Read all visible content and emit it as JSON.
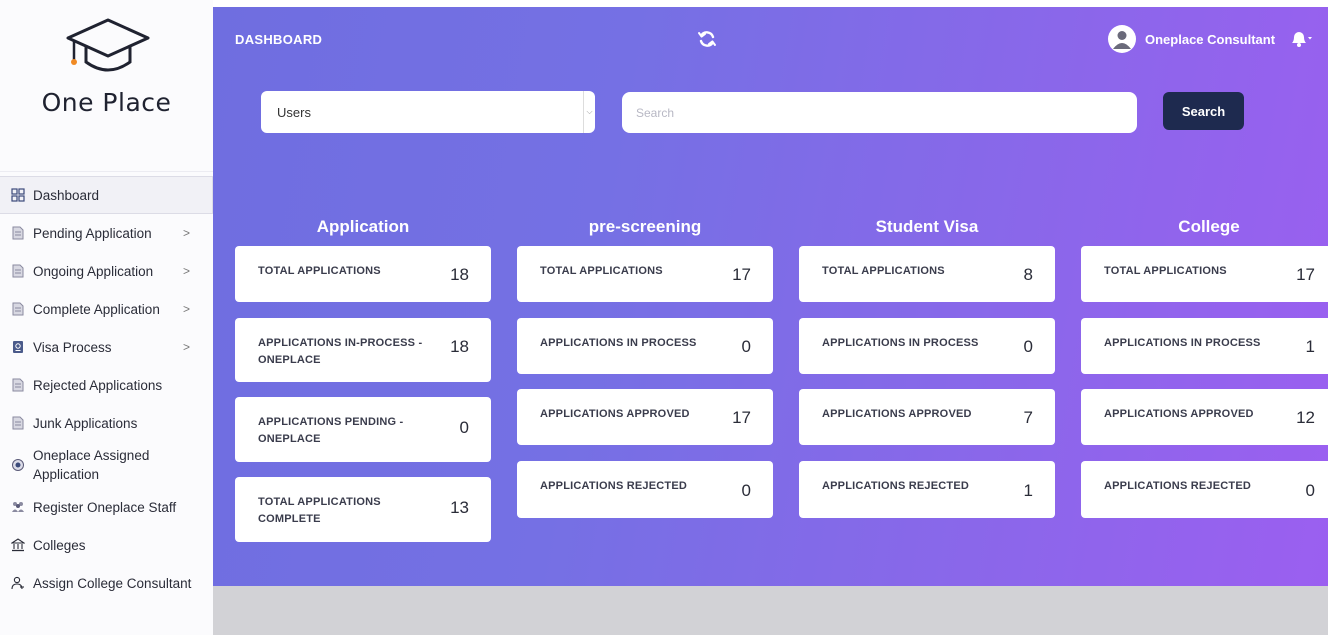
{
  "brand": {
    "name": "One Place",
    "logo_icon": "graduation-cap-icon"
  },
  "sidebar": {
    "items": [
      {
        "label": "Dashboard",
        "icon": "grid-icon",
        "active": true,
        "chevron": false
      },
      {
        "label": "Pending Application",
        "icon": "document-icon",
        "chevron": true
      },
      {
        "label": "Ongoing Application",
        "icon": "document-icon",
        "chevron": true
      },
      {
        "label": "Complete Application",
        "icon": "document-icon",
        "chevron": true
      },
      {
        "label": "Visa Process",
        "icon": "passport-icon",
        "chevron": true
      },
      {
        "label": "Rejected Applications",
        "icon": "document-icon",
        "chevron": false
      },
      {
        "label": "Junk Applications",
        "icon": "document-icon",
        "chevron": false
      },
      {
        "label": "Oneplace Assigned Application",
        "icon": "badge-icon",
        "chevron": false
      },
      {
        "label": "Register Oneplace Staff",
        "icon": "staff-icon",
        "chevron": false
      },
      {
        "label": "Colleges",
        "icon": "building-icon",
        "chevron": false
      },
      {
        "label": "Assign College Consultant",
        "icon": "user-assign-icon",
        "chevron": false
      }
    ],
    "chevron_glyph": ">"
  },
  "header": {
    "title": "DASHBOARD",
    "user_name": "Oneplace Consultant",
    "refresh_icon": "refresh-icon",
    "bell_icon": "bell-icon"
  },
  "filter": {
    "select_value": "Users",
    "search_placeholder": "Search",
    "search_button": "Search"
  },
  "colors": {
    "gradient_start": "#6f6ee0",
    "gradient_end": "#9b5ff0",
    "search_button": "#1e2a4f",
    "card": "#ffffff"
  },
  "sections": [
    {
      "title": "Application",
      "cards": [
        {
          "label": "TOTAL APPLICATIONS",
          "value": "18"
        },
        {
          "label": "APPLICATIONS IN-PROCESS - ONEPLACE",
          "value": "18"
        },
        {
          "label": "APPLICATIONS PENDING - ONEPLACE",
          "value": "0"
        },
        {
          "label": "TOTAL APPLICATIONS COMPLETE",
          "value": "13"
        }
      ]
    },
    {
      "title": "pre-screening",
      "cards": [
        {
          "label": "TOTAL APPLICATIONS",
          "value": "17"
        },
        {
          "label": "APPLICATIONS IN PROCESS",
          "value": "0"
        },
        {
          "label": "APPLICATIONS APPROVED",
          "value": "17"
        },
        {
          "label": "APPLICATIONS REJECTED",
          "value": "0"
        }
      ]
    },
    {
      "title": "Student Visa",
      "cards": [
        {
          "label": "TOTAL APPLICATIONS",
          "value": "8"
        },
        {
          "label": "APPLICATIONS IN PROCESS",
          "value": "0"
        },
        {
          "label": "APPLICATIONS APPROVED",
          "value": "7"
        },
        {
          "label": "APPLICATIONS REJECTED",
          "value": "1"
        }
      ]
    },
    {
      "title": "College",
      "cards": [
        {
          "label": "TOTAL APPLICATIONS",
          "value": "17"
        },
        {
          "label": "APPLICATIONS IN PROCESS",
          "value": "1"
        },
        {
          "label": "APPLICATIONS APPROVED",
          "value": "12"
        },
        {
          "label": "APPLICATIONS REJECTED",
          "value": "0"
        }
      ]
    }
  ]
}
